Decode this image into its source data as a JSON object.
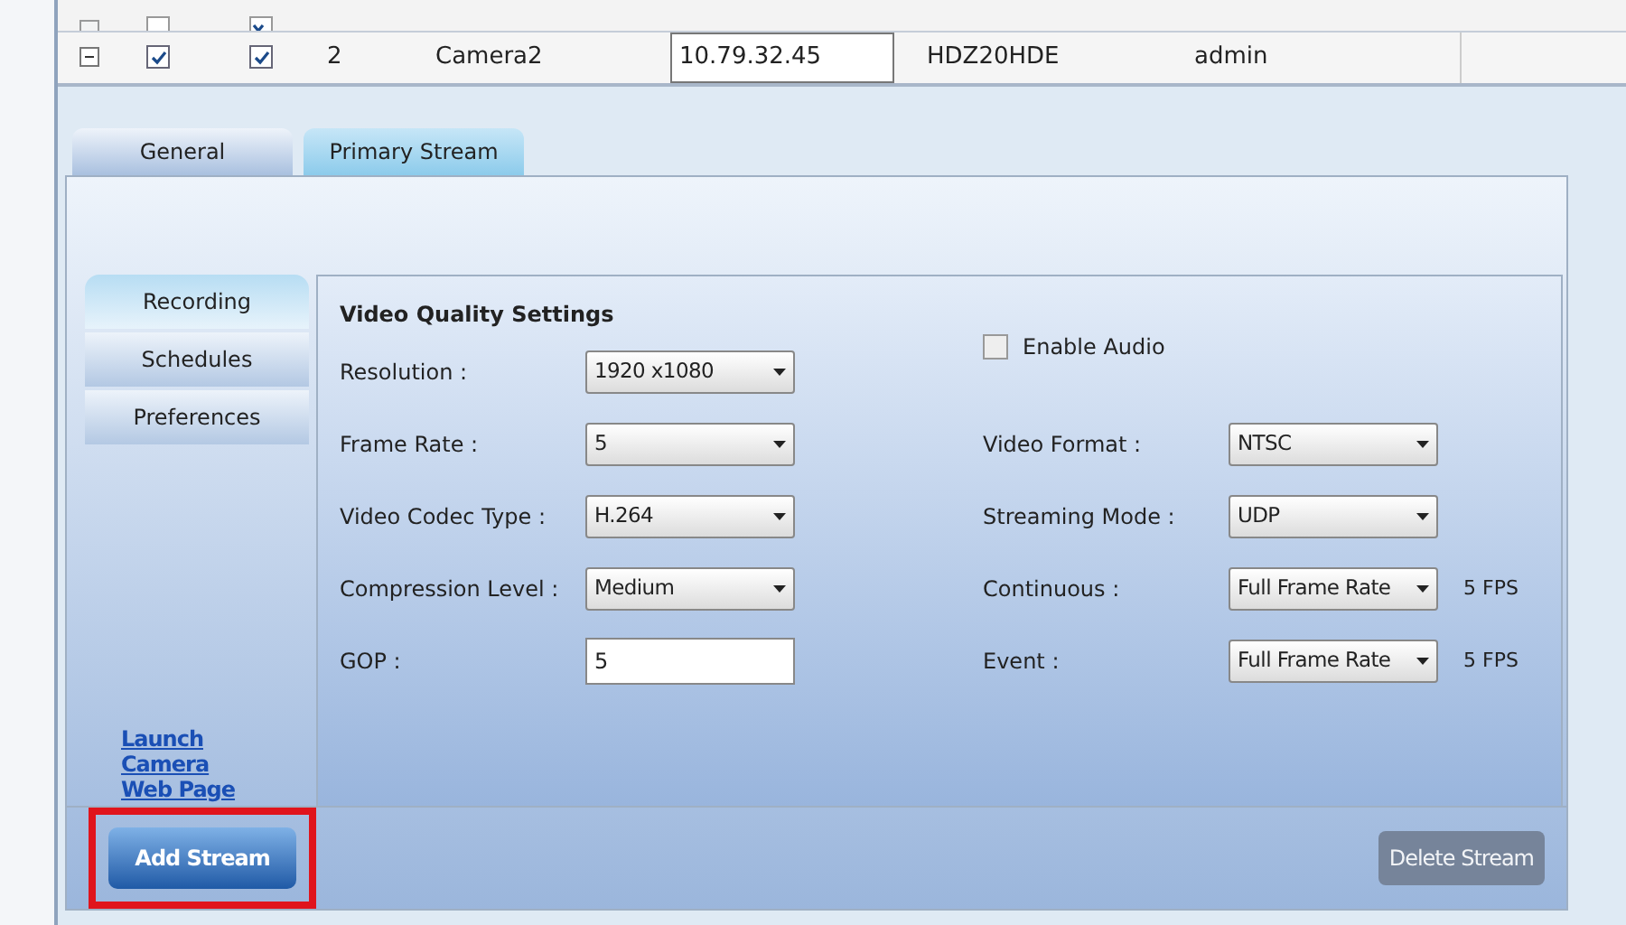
{
  "partial_row": {
    "enabled": false,
    "recording": true
  },
  "camera_row": {
    "expanded": true,
    "enabled": true,
    "recording": true,
    "number": "2",
    "name": "Camera2",
    "ip": "10.79.32.45",
    "model": "HDZ20HDE",
    "user": "admin"
  },
  "tabs": [
    {
      "label": "General",
      "selected": false
    },
    {
      "label": "Primary Stream",
      "selected": true
    }
  ],
  "side_nav": [
    {
      "label": "Recording",
      "selected": true
    },
    {
      "label": "Schedules",
      "selected": false
    },
    {
      "label": "Preferences",
      "selected": false
    }
  ],
  "launch_link": "Launch Camera Web Page",
  "settings": {
    "title": "Video Quality Settings",
    "left": [
      {
        "kind": "select",
        "label": "Resolution :",
        "value": "1920 x1080"
      },
      {
        "kind": "select",
        "label": "Frame Rate :",
        "value": "5"
      },
      {
        "kind": "select",
        "label": "Video Codec Type :",
        "value": "H.264"
      },
      {
        "kind": "select",
        "label": "Compression Level :",
        "value": "Medium"
      },
      {
        "kind": "input",
        "label": "GOP :",
        "value": "5"
      }
    ],
    "right": [
      {
        "kind": "checkbox",
        "label": "Enable Audio",
        "checked": false
      },
      {
        "kind": "select",
        "label": "Video Format :",
        "value": "NTSC"
      },
      {
        "kind": "select",
        "label": "Streaming Mode :",
        "value": "UDP"
      },
      {
        "kind": "select",
        "label": "Continuous :",
        "value": "Full Frame Rate",
        "suffix": "5 FPS"
      },
      {
        "kind": "select",
        "label": "Event :",
        "value": "Full Frame Rate",
        "suffix": "5 FPS"
      }
    ]
  },
  "add_button": {
    "label": "Add Stream",
    "highlighted": true
  },
  "delete_button": {
    "label": "Delete Stream",
    "disabled": true
  }
}
